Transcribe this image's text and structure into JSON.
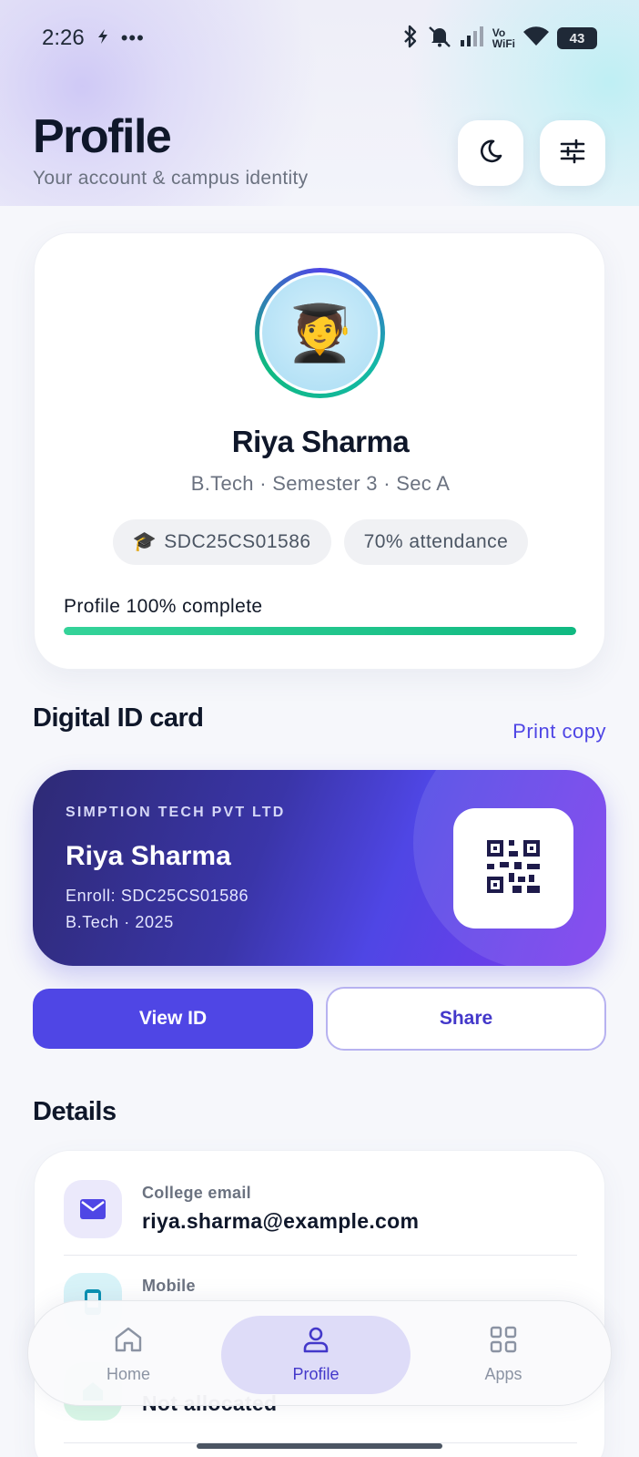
{
  "status_bar": {
    "time": "2:26",
    "battery": "43",
    "vowifi_top": "Vo",
    "vowifi_bottom": "WiFi"
  },
  "header": {
    "title": "Profile",
    "subtitle": "Your account & campus identity",
    "theme_button_icon": "moon-icon",
    "settings_button_icon": "sliders-icon"
  },
  "profile": {
    "avatar_emoji": "🧑‍🎓",
    "name": "Riya Sharma",
    "program": "B.Tech · Semester 3 · Sec A",
    "chips": {
      "enroll_icon": "🎓",
      "enroll": "SDC25CS01586",
      "attendance": "70% attendance"
    },
    "completion_label": "Profile 100% complete",
    "completion": 1.0
  },
  "id_section": {
    "title": "Digital ID card",
    "print_link": "Print copy",
    "card": {
      "org": "SIMPTION TECH PVT LTD",
      "name": "Riya Sharma",
      "enroll_line": "Enroll: SDC25CS01586",
      "course_line": "B.Tech · 2025"
    },
    "view_button": "View ID",
    "share_button": "Share"
  },
  "details": {
    "title": "Details",
    "rows": [
      {
        "label": "College email",
        "value": "riya.sharma@example.com",
        "icon": "mail-icon"
      },
      {
        "label": "Mobile",
        "value": "",
        "icon": "phone-icon"
      },
      {
        "label": "",
        "value": "Not allocated",
        "icon": "home-icon"
      }
    ]
  },
  "bottom_nav": {
    "items": [
      {
        "label": "Home",
        "icon": "home-icon"
      },
      {
        "label": "Profile",
        "icon": "user-icon"
      },
      {
        "label": "Apps",
        "icon": "grid-icon"
      }
    ]
  },
  "colors": {
    "accent": "#4f46e5",
    "success": "#10b981",
    "background": "#f6f7fb"
  }
}
